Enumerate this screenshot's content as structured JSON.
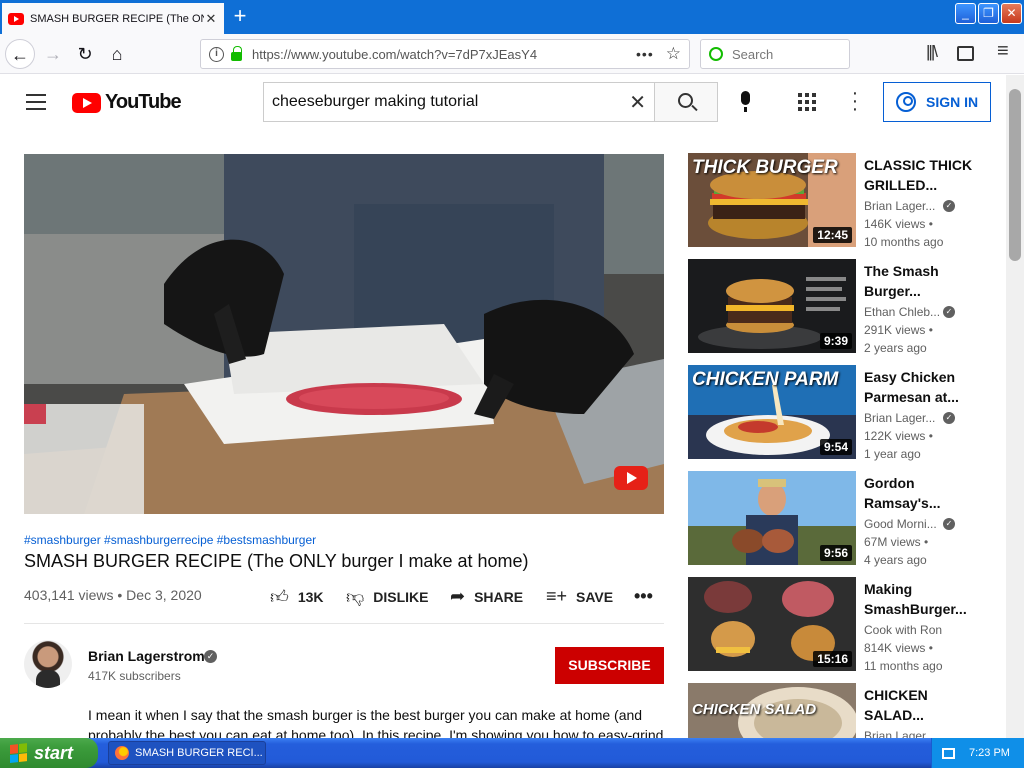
{
  "browser": {
    "tab_title": "SMASH BURGER RECIPE (The ONLY",
    "url": "https://www.youtube.com/watch?v=7dP7xJEasY4",
    "search_placeholder": "Search"
  },
  "youtube": {
    "logo_text": "YouTube",
    "search_query": "cheeseburger making tutorial",
    "sign_in": "SIGN IN"
  },
  "video": {
    "hashtags": "#smashburger #smashburgerrecipe #bestsmashburger",
    "title": "SMASH BURGER RECIPE (The ONLY burger I make at home)",
    "meta": "403,141 views • Dec 3, 2020",
    "actions": {
      "like": "13K",
      "dislike": "DISLIKE",
      "share": "SHARE",
      "save": "SAVE"
    },
    "channel": {
      "name": "Brian Lagerstrom",
      "subscribers": "417K subscribers",
      "subscribe": "SUBSCRIBE"
    },
    "description": "I mean it when I say that the smash burger is the best burger you can make at home (and probably the best you can eat at home too). In this recipe, I'm showing you how to easy-grind"
  },
  "recommendations": [
    {
      "title": "CLASSIC THICK GRILLED...",
      "channel": "Brian Lager...",
      "views": "146K views •",
      "age": "10 months ago",
      "duration": "12:45",
      "thumb_text": "THICK BURGER"
    },
    {
      "title": "The Smash Burger...",
      "channel": "Ethan Chleb...",
      "views": "291K views •",
      "age": "2 years ago",
      "duration": "9:39",
      "thumb_text": ""
    },
    {
      "title": "Easy Chicken Parmesan at...",
      "channel": "Brian Lager...",
      "views": "122K views •",
      "age": "1 year ago",
      "duration": "9:54",
      "thumb_text": "CHICKEN PARM"
    },
    {
      "title": "Gordon Ramsay's...",
      "channel": "Good Morni...",
      "views": "67M views •",
      "age": "4 years ago",
      "duration": "9:56",
      "thumb_text": ""
    },
    {
      "title": "Making SmashBurger...",
      "channel": "Cook with Ron",
      "views": "814K views •",
      "age": "11 months ago",
      "duration": "15:16",
      "thumb_text": ""
    },
    {
      "title": "CHICKEN SALAD...",
      "channel": "Brian Lager...",
      "views": "",
      "age": "",
      "duration": "",
      "thumb_text": "CHICKEN SALAD"
    }
  ],
  "taskbar": {
    "start": "start",
    "task_item": "SMASH BURGER RECI...",
    "clock": "7:23 PM"
  }
}
